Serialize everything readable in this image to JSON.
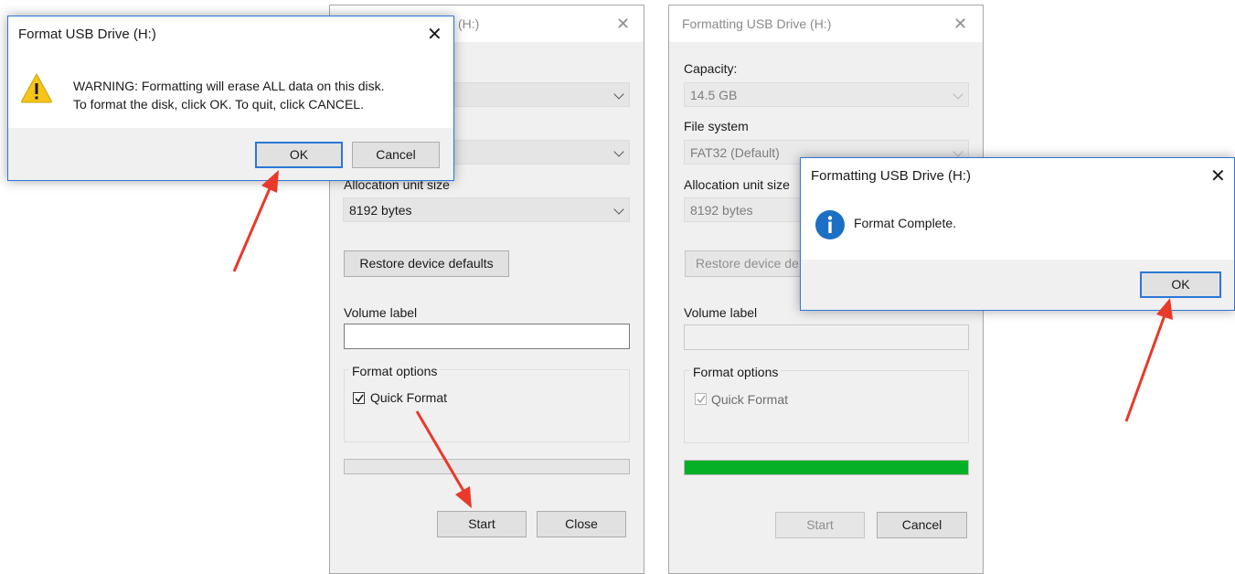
{
  "format_dialog": {
    "title_partial": "(H:)",
    "allocation_label": "Allocation unit size",
    "allocation_value": "8192 bytes",
    "restore_label": "Restore device defaults",
    "volume_label": "Volume label",
    "volume_value": "",
    "format_options_title": "Format options",
    "quick_format_label": "Quick Format",
    "quick_format_checked": true,
    "progress_fraction": 0,
    "start_label": "Start",
    "close_label": "Close"
  },
  "warning_box": {
    "title": "Format USB Drive (H:)",
    "line1": "WARNING: Formatting will erase ALL data on this disk.",
    "line2": "To format the disk, click OK. To quit, click CANCEL.",
    "ok_label": "OK",
    "cancel_label": "Cancel",
    "icon": "warning-icon"
  },
  "formatting_dialog": {
    "title": "Formatting USB Drive (H:)",
    "capacity_label": "Capacity:",
    "capacity_value": "14.5 GB",
    "filesystem_label": "File system",
    "filesystem_value": "FAT32 (Default)",
    "allocation_label": "Allocation unit size",
    "allocation_value": "8192 bytes",
    "restore_label": "Restore device de",
    "volume_label": "Volume label",
    "format_options_title": "Format options",
    "quick_format_label": "Quick Format",
    "progress_fraction": 1.0,
    "start_label": "Start",
    "cancel_label": "Cancel"
  },
  "complete_box": {
    "title": "Formatting USB Drive (H:)",
    "message": "Format Complete.",
    "ok_label": "OK",
    "icon": "info-icon"
  },
  "colors": {
    "accent": "#2a78d6",
    "progress_green": "#06b025",
    "arrow_red": "#e8392b"
  }
}
